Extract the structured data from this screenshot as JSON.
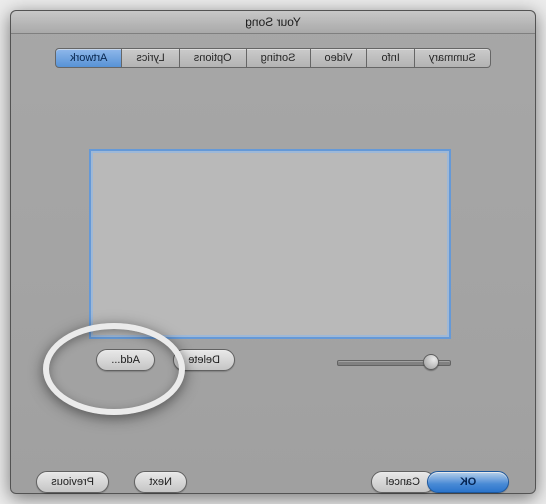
{
  "window": {
    "title": "Your Song"
  },
  "tabs": {
    "summary": "Summary",
    "info": "Info",
    "video": "Video",
    "sorting": "Sorting",
    "options": "Options",
    "lyrics": "Lyrics",
    "artwork": "Artwork"
  },
  "buttons": {
    "add": "Add...",
    "delete": "Delete",
    "previous": "Previous",
    "next": "Next",
    "cancel": "Cancel",
    "ok": "OK"
  }
}
